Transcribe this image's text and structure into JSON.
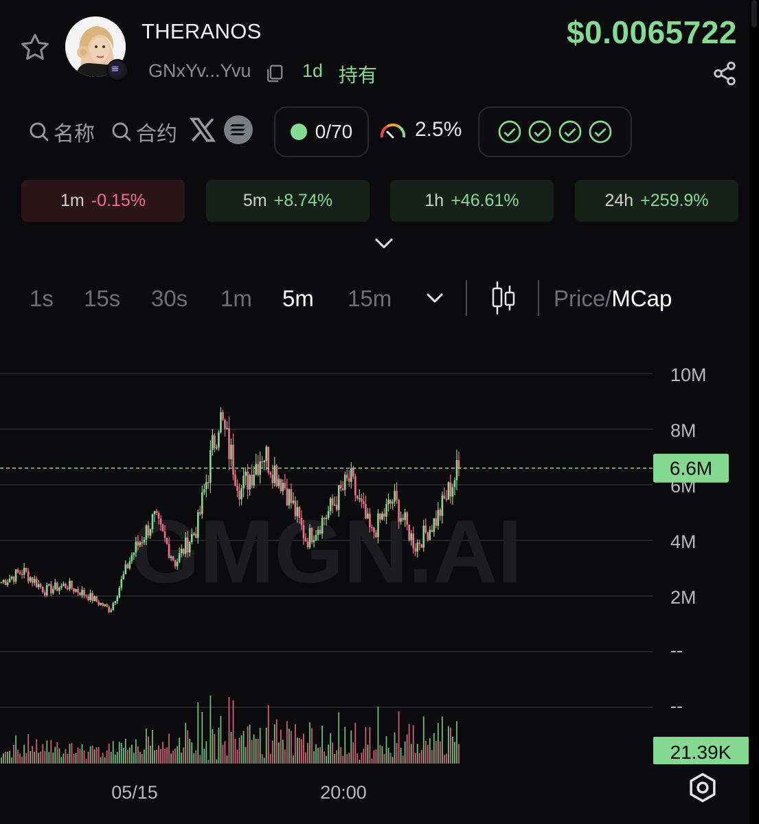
{
  "header": {
    "token_name": "THERANOS",
    "address": "GNxYv...Yvu",
    "age": "1d",
    "hold_label": "持有",
    "price": "$0.0065722",
    "icons": [
      "star-icon",
      "copy-icon",
      "share-icon",
      "solana-badge-icon"
    ]
  },
  "filters": {
    "search_name": "名称",
    "search_contract": "合约",
    "holders": "0/70",
    "tax": "2.5%",
    "checks_count": 4
  },
  "changes": [
    {
      "period": "1m",
      "value": "-0.15%",
      "trend": "neg"
    },
    {
      "period": "5m",
      "value": "+8.74%",
      "trend": "pos"
    },
    {
      "period": "1h",
      "value": "+46.61%",
      "trend": "pos"
    },
    {
      "period": "24h",
      "value": "+259.9%",
      "trend": "pos"
    }
  ],
  "toolbar": {
    "timeframes": [
      "1s",
      "15s",
      "30s",
      "1m",
      "5m",
      "15m"
    ],
    "active_timeframe": "5m",
    "price_label": "Price/",
    "mcap_label": "MCap"
  },
  "colors": {
    "accent_green": "#86d993",
    "up": "#86d993",
    "down": "#f2718a",
    "background": "#0b0b0d"
  },
  "chart_data": {
    "type": "candlestick",
    "watermark": "GMGN.AI",
    "y_ticks": [
      "10M",
      "8M",
      "6M",
      "4M",
      "2M",
      "--"
    ],
    "volume_ticks": [
      "--"
    ],
    "ylim": [
      0,
      10000000
    ],
    "current_value": 6600000,
    "current_label": "6.6M",
    "volume_current_label": "21.39K",
    "x_ticks": [
      "05/15",
      "20:00"
    ],
    "series": [
      {
        "name": "MCap",
        "values": [
          2500000,
          2900000,
          2200000,
          2400000,
          2000000,
          1500000,
          3500000,
          4800000,
          3200000,
          4500000,
          8500000,
          5800000,
          7200000,
          6000000,
          4000000,
          5000000,
          6200000,
          4200000,
          5500000,
          3800000,
          4800000,
          6600000
        ]
      }
    ]
  }
}
